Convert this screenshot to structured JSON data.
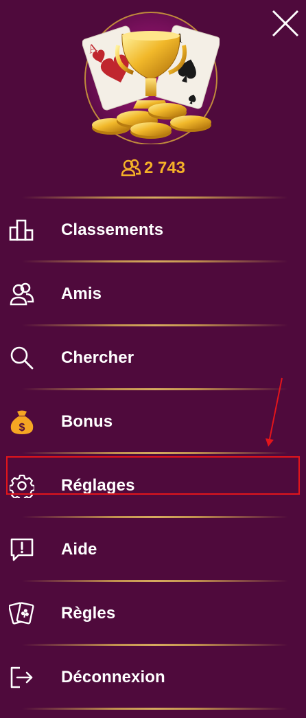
{
  "header": {
    "player_count": "2 743",
    "close_icon": "close-icon",
    "logo_icon": "trophy-cards-coins-logo",
    "count_icon": "users-icon",
    "count_color": "#f5b128"
  },
  "menu": {
    "items": [
      {
        "label": "Classements",
        "icon": "ranking-bars-icon"
      },
      {
        "label": "Amis",
        "icon": "friends-icon"
      },
      {
        "label": "Chercher",
        "icon": "search-icon"
      },
      {
        "label": "Bonus",
        "icon": "money-bag-icon"
      },
      {
        "label": "Réglages",
        "icon": "gear-icon"
      },
      {
        "label": "Aide",
        "icon": "help-bubble-icon"
      },
      {
        "label": "Règles",
        "icon": "playing-cards-icon"
      },
      {
        "label": "Déconnexion",
        "icon": "logout-icon"
      }
    ]
  },
  "colors": {
    "background": "#4f0a3c",
    "divider": "#c99a50",
    "annotation": "#e3151b"
  }
}
